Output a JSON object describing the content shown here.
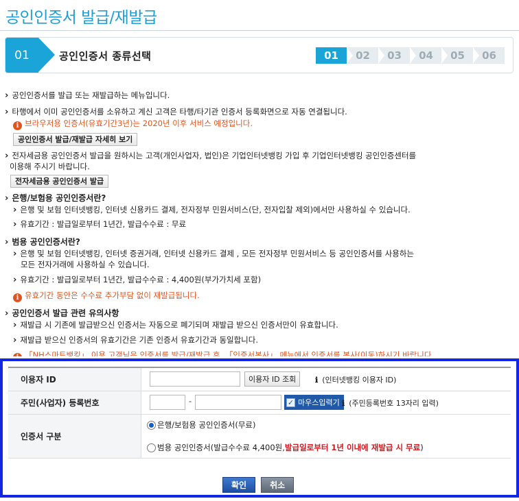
{
  "page": {
    "title": "공인인증서 발급/재발급"
  },
  "step": {
    "current_num": "01",
    "current_title": "공인인증서 종류선택",
    "steps": [
      "01",
      "02",
      "03",
      "04",
      "05",
      "06"
    ],
    "active_color": "#1aa4d8"
  },
  "notes": {
    "n1": "공인인증서를 발급 또는 재발급하는 메뉴입니다.",
    "n2": "타행에서 이미 공인인증서를 소유하고 계신 고객은 타행/타기관 인증서 등록화면으로 자동 연결됩니다.",
    "n3_info": "브라우저용 인증서(유효기간3년)는 2020년 이후 서비스 예정입니다.",
    "btn_detail": "공인인증서 발급/재발급 자세히 보기",
    "n4_line1": "전자세금용 공인인증서 발급을 원하시는 고객(개인사업자, 법인)은 기업인터넷뱅킹 가입 후 기업인터넷뱅킹 공인인증센터를",
    "n4_line2": "이용해 주시기 바랍니다.",
    "btn_tax": "전자세금용 공인인증서 발급",
    "h1": "은행/보험용 공인인증서란?",
    "h1_l1": "은행 및 보험 인터넷뱅킹, 인터넷 신용카드 결제, 전자정부 민원서비스(단, 전자입찰 제외)에서만 사용하실 수 있습니다.",
    "h1_l2": "유효기간 : 발급일로부터 1년간, 발급수수료 : 무료",
    "h2": "범용 공인인증서란?",
    "h2_l1a": "은행 및 보험 인터넷뱅킹, 인터넷 증권거래, 인터넷 신용카드 결제 , 모든 전자정부 민원서비스 등 공인인증서를 사용하는",
    "h2_l1b": "모든 전자거래에 사용하실 수 있습니다.",
    "h2_l2": "유효기간 : 발급일로부터 1년간, 발급수수료 : 4,400원(부가가치세 포함)",
    "h2_info": "유효기간 동안은 수수료 추가부담 없이 재발급됩니다.",
    "h3": "공인인증서 발급 관련 유의사항",
    "h3_l1": "재발급 시 기존에 발급받으신 인증서는 자동으로 폐기되며 재발급 받으신 인증서만이 유효합니다.",
    "h3_l2": "재발급 받으신 인증서의 유효기간은 기존 인증서 유효기간과 동일합니다.",
    "h3_info": "「NH스마트뱅킹」 이용 고객님은 인증서를 발급/재발급 후, 「인증서복사」 메뉴에서 인증서를 복사(이동)하시기 바랍니다."
  },
  "form": {
    "user_id_label": "이용자 ID",
    "user_id_value": "",
    "user_id_lookup": "이용자 ID 조회",
    "user_id_hint": "(인터넷뱅킹 이용자 ID)",
    "reg_label": "주민(사업자) 등록번호",
    "reg_value_1": "",
    "reg_value_2": "",
    "reg_dash": "-",
    "mouse_input": "마우스입력기",
    "reg_hint": "(주민등록번호 13자리 입력)",
    "cert_label": "인증서 구분",
    "opt_bank": "은행/보험용 공인인증서(무료)",
    "opt_general": "범용 공인인증서(발급수수료 4,400원, ",
    "opt_general_red": "발급일로부터 1년 이내에 재발급 시 무료",
    "opt_general_end": ")",
    "info_glyph": "ℹ",
    "ok": "확인",
    "cancel": "취소"
  }
}
